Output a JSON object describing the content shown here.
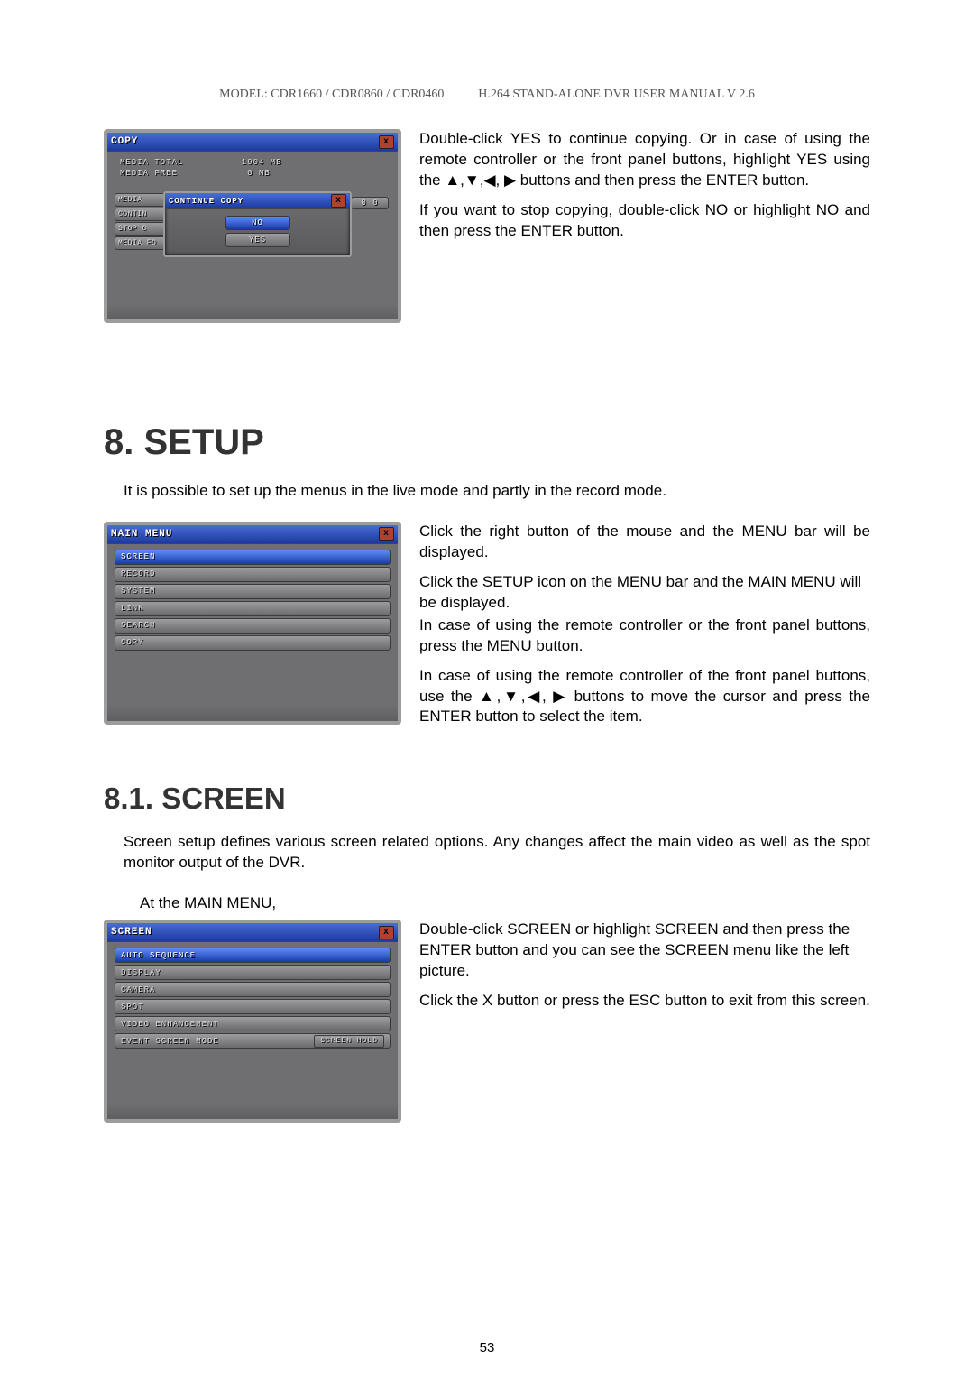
{
  "header": {
    "model": "MODEL: CDR1660 / CDR0860 / CDR0460",
    "doc": "H.264 STAND-ALONE DVR USER MANUAL V 2.6"
  },
  "page_number": "53",
  "copy_panel": {
    "title": "COPY",
    "media_total_label": "MEDIA TOTAL",
    "media_total_value": "1904 MB",
    "media_free_label": "MEDIA FREE",
    "media_free_value": "0 MB",
    "side_media": "MEDIA",
    "side_contin": "CONTIN",
    "side_stop": "STOP C",
    "side_format": "MEDIA FO",
    "trailing_val": "0 0",
    "sub_title": "CONTINUE COPY",
    "btn_no": "NO",
    "btn_yes": "YES"
  },
  "copy_text": {
    "p1": "Double-click YES to continue copying. Or in case of using the remote controller or the front panel buttons, highlight YES using the ▲,▼,◀, ▶ buttons and then press the ENTER button.",
    "p2": "If you want to stop copying, double-click NO or highlight NO and then press the ENTER button."
  },
  "setup": {
    "heading": "8.    SETUP",
    "intro": "It is possible to set up the menus in the live mode and partly in the record mode."
  },
  "main_menu_panel": {
    "title": "MAIN MENU",
    "items": [
      "SCREEN",
      "RECORD",
      "SYSTEM",
      "LINK",
      "SEARCH",
      "COPY"
    ]
  },
  "main_menu_text": {
    "p1": "Click the right button of the mouse and the MENU bar will be displayed.",
    "p2": "Click the SETUP icon on the MENU bar and the MAIN MENU will be displayed.",
    "p3": "In case of using the remote controller or the front panel buttons, press the MENU button.",
    "p4": "In case of using the remote controller of the front panel buttons, use the ▲,▼,◀, ▶ buttons to move the cursor and press the ENTER button to select the item."
  },
  "screen_section": {
    "heading": "8.1. SCREEN",
    "intro": "Screen setup defines various screen related options.   Any changes affect the main video as well as the spot monitor output of the DVR.",
    "at_main": "At the MAIN MENU,"
  },
  "screen_panel": {
    "title": "SCREEN",
    "items": [
      "AUTO SEQUENCE",
      "DISPLAY",
      "CAMERA",
      "SPOT",
      "VIDEO ENHANCEMENT"
    ],
    "last_item_label": "EVENT SCREEN MODE",
    "last_item_value": "SCREEN HOLD"
  },
  "screen_text": {
    "p1": "Double-click SCREEN or highlight SCREEN and then press the ENTER button and you can see the SCREEN menu like the left picture.",
    "p2": "Click the X button or press the ESC button to exit from this screen."
  }
}
